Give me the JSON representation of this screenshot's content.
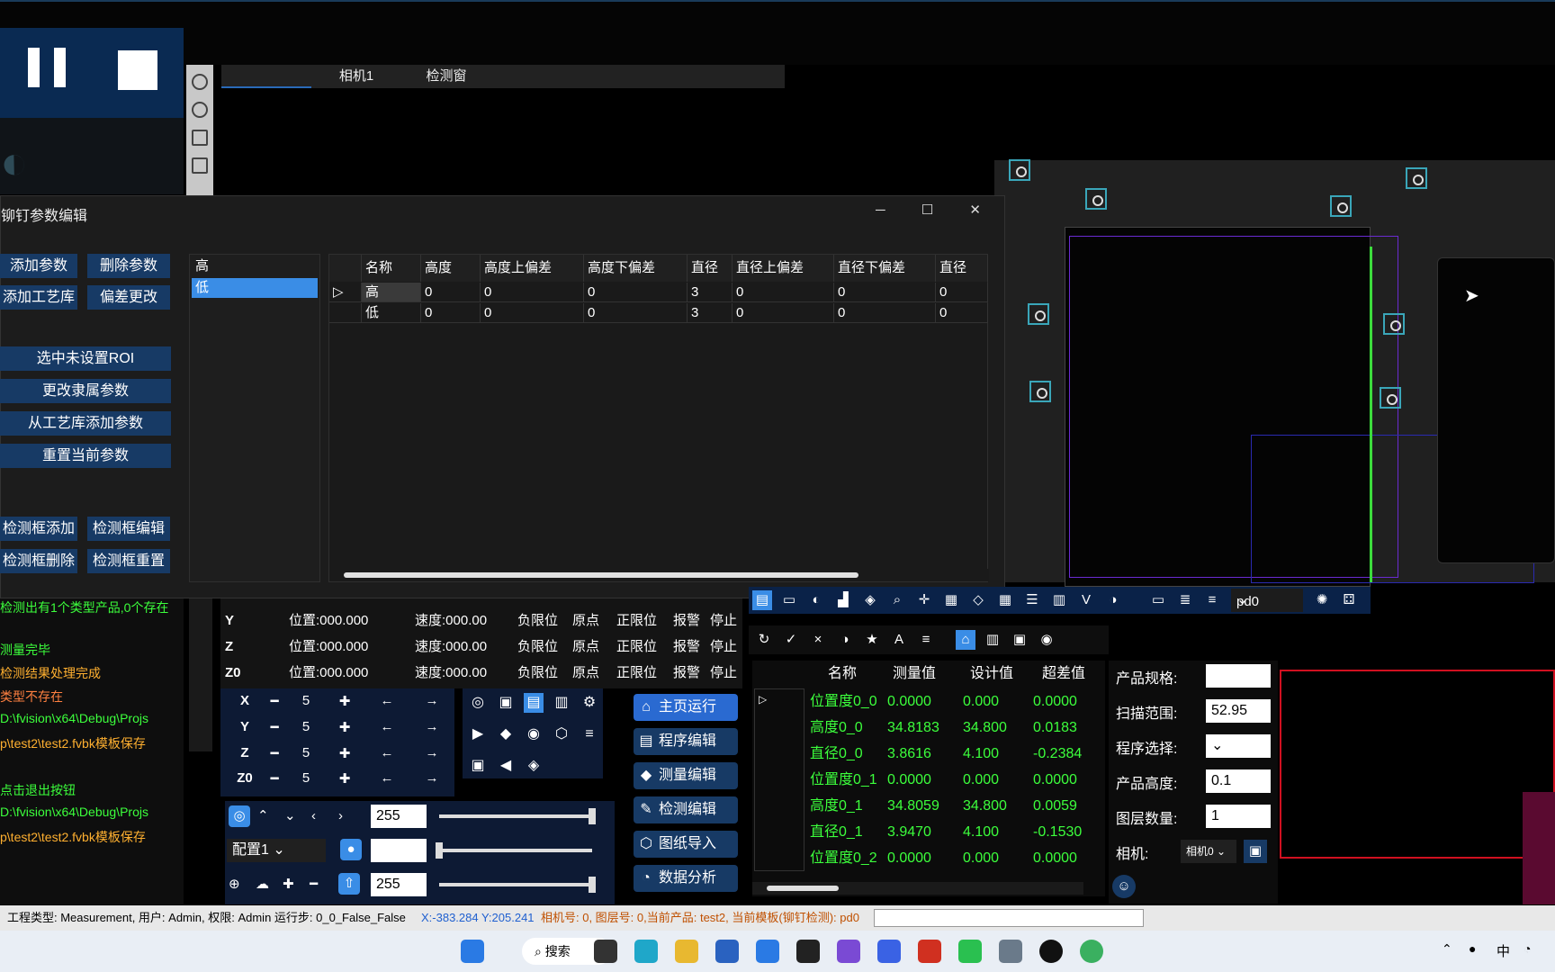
{
  "tabs": [
    "相机1",
    "检测窗"
  ],
  "dialog": {
    "title": "铆钉参数编辑",
    "buttons": {
      "add_param": "添加参数",
      "delete_param": "删除参数",
      "add_library": "添加工艺库",
      "deviation_change": "偏差更改",
      "no_roi": "选中未设置ROI",
      "change_param": "更改隶属参数",
      "add_from_library": "从工艺库添加参数",
      "reset_param": "重置当前参数",
      "box_add": "检测框添加",
      "box_edit": "检测框编辑",
      "box_delete": "检测框删除",
      "box_reset": "检测框重置"
    },
    "list": [
      "高",
      "低"
    ],
    "columns": [
      "名称",
      "高度",
      "高度上偏差",
      "高度下偏差",
      "直径",
      "直径上偏差",
      "直径下偏差",
      "直径"
    ],
    "rows": [
      [
        "高",
        "0",
        "0",
        "0",
        "3",
        "0",
        "0",
        "0"
      ],
      [
        "低",
        "0",
        "0",
        "0",
        "3",
        "0",
        "0",
        "0"
      ]
    ]
  },
  "log": [
    {
      "text": "检测出有1个类型产品,0个存在",
      "color": "#3cff3c"
    },
    {
      "text": "测量完毕",
      "color": "#3cff3c"
    },
    {
      "text": "检测结果处理完成",
      "color": "#ffb030"
    },
    {
      "text": "类型不存在",
      "color": "#ff8040"
    },
    {
      "text": "D:\\fvision\\x64\\Debug\\Projs",
      "color": "#3cff3c"
    },
    {
      "text": "p\\test2\\test2.fvbk模板保存",
      "color": "#ffb030"
    },
    {
      "text": "点击退出按钮",
      "color": "#3cff3c"
    },
    {
      "text": "D:\\fvision\\x64\\Debug\\Projs",
      "color": "#3cff3c"
    },
    {
      "text": "p\\test2\\test2.fvbk模板保存",
      "color": "#ffb030"
    }
  ],
  "axes": [
    {
      "name": "Y",
      "pos": "位置:000.000",
      "speed": "速度:000.00"
    },
    {
      "name": "Z",
      "pos": "位置:000.000",
      "speed": "速度:000.00"
    },
    {
      "name": "Z0",
      "pos": "位置:000.000",
      "speed": "速度:000.00"
    }
  ],
  "axis_flags": [
    "负限位",
    "原点",
    "正限位",
    "报警",
    "停止"
  ],
  "jog": [
    {
      "name": "X",
      "step": "5"
    },
    {
      "name": "Y",
      "step": "5"
    },
    {
      "name": "Z",
      "step": "5"
    },
    {
      "name": "Z0",
      "step": "5"
    }
  ],
  "nav": [
    "主页运行",
    "程序编辑",
    "测量编辑",
    "检测编辑",
    "图纸导入",
    "数据分析"
  ],
  "light": {
    "value1": "255",
    "config": "配置1",
    "value2": "255"
  },
  "toolbar2_select": "pd0",
  "measure": {
    "columns": [
      "名称",
      "测量值",
      "设计值",
      "超差值"
    ],
    "rows": [
      [
        "位置度0_0",
        "0.0000",
        "0.000",
        "0.0000"
      ],
      [
        "高度0_0",
        "34.8183",
        "34.800",
        "0.0183"
      ],
      [
        "直径0_0",
        "3.8616",
        "4.100",
        "-0.2384"
      ],
      [
        "位置度0_1",
        "0.0000",
        "0.000",
        "0.0000"
      ],
      [
        "高度0_1",
        "34.8059",
        "34.800",
        "0.0059"
      ],
      [
        "直径0_1",
        "3.9470",
        "4.100",
        "-0.1530"
      ],
      [
        "位置度0_2",
        "0.0000",
        "0.000",
        "0.0000"
      ]
    ]
  },
  "props": {
    "spec_label": "产品规格:",
    "spec_value": "",
    "scan_label": "扫描范围:",
    "scan_value": "52.95",
    "program_label": "程序选择:",
    "height_label": "产品高度:",
    "height_value": "0.1",
    "layers_label": "图层数量:",
    "layers_value": "1",
    "camera_label": "相机:",
    "camera_value": "相机0"
  },
  "status": {
    "text": "工程类型: Measurement, 用户: Admin, 权限: Admin   运行步: 0_0_False_False",
    "coords": "X:-383.284  Y:205.241",
    "info": "相机号: 0, 图层号: 0,当前产品: test2, 当前模板(铆钉检测): pd0"
  },
  "taskbar": {
    "search": "搜索",
    "ime": "中"
  },
  "colors": {
    "accent": "#173a65",
    "measure_green": "#3cff3c",
    "roi": "#3aa6b9"
  }
}
